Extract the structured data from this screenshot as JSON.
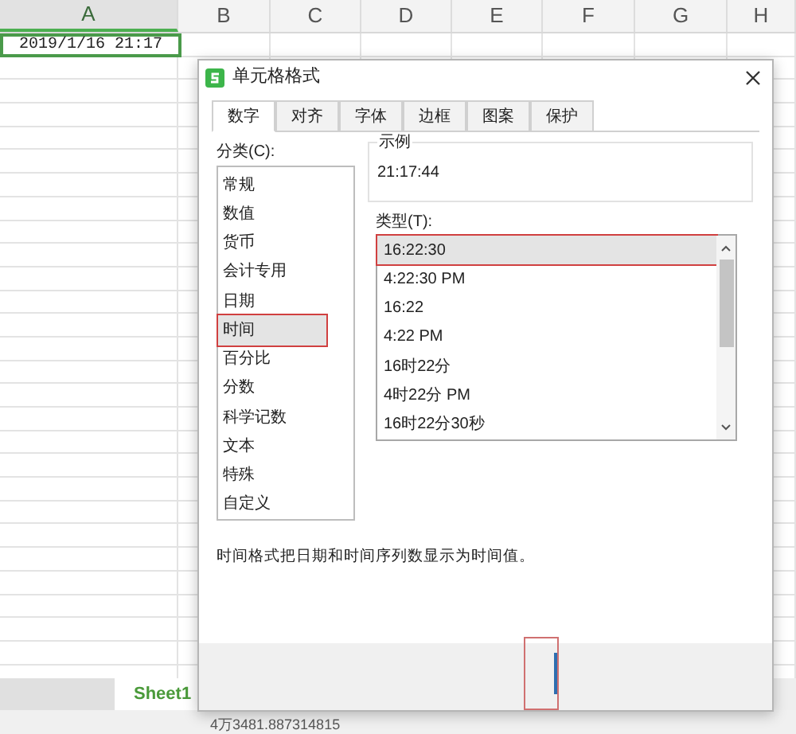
{
  "sheet": {
    "columns": [
      {
        "label": "A",
        "selected": true
      },
      {
        "label": "B",
        "selected": false
      },
      {
        "label": "C",
        "selected": false
      },
      {
        "label": "D",
        "selected": false
      },
      {
        "label": "E",
        "selected": false
      },
      {
        "label": "F",
        "selected": false
      },
      {
        "label": "G",
        "selected": false
      },
      {
        "label": "H",
        "selected": false
      }
    ],
    "active_cell": "2019/1/16 21:17",
    "sheet_tab": "Sheet1",
    "status": "4万3481.887314815"
  },
  "dialog": {
    "title": "单元格格式",
    "tabs": [
      {
        "label": "数字",
        "selected": true
      },
      {
        "label": "对齐",
        "selected": false
      },
      {
        "label": "字体",
        "selected": false
      },
      {
        "label": "边框",
        "selected": false
      },
      {
        "label": "图案",
        "selected": false
      },
      {
        "label": "保护",
        "selected": false
      }
    ],
    "category_label": "分类(C):",
    "categories": [
      {
        "label": "常规",
        "selected": false,
        "annotated": false
      },
      {
        "label": "数值",
        "selected": false,
        "annotated": false
      },
      {
        "label": "货币",
        "selected": false,
        "annotated": false
      },
      {
        "label": "会计专用",
        "selected": false,
        "annotated": false
      },
      {
        "label": "日期",
        "selected": false,
        "annotated": false
      },
      {
        "label": "时间",
        "selected": true,
        "annotated": true
      },
      {
        "label": "百分比",
        "selected": false,
        "annotated": false
      },
      {
        "label": "分数",
        "selected": false,
        "annotated": false
      },
      {
        "label": "科学记数",
        "selected": false,
        "annotated": false
      },
      {
        "label": "文本",
        "selected": false,
        "annotated": false
      },
      {
        "label": "特殊",
        "selected": false,
        "annotated": false
      },
      {
        "label": "自定义",
        "selected": false,
        "annotated": false
      }
    ],
    "sample": {
      "label": "示例",
      "value": "21:17:44"
    },
    "type_label": "类型(T):",
    "types": [
      {
        "label": "16:22:30",
        "selected": true,
        "annotated": true
      },
      {
        "label": "4:22:30 PM",
        "selected": false,
        "annotated": false
      },
      {
        "label": "16:22",
        "selected": false,
        "annotated": false
      },
      {
        "label": "4:22 PM",
        "selected": false,
        "annotated": false
      },
      {
        "label": "16时22分",
        "selected": false,
        "annotated": false
      },
      {
        "label": "4时22分 PM",
        "selected": false,
        "annotated": false
      },
      {
        "label": "16时22分30秒",
        "selected": false,
        "annotated": false
      }
    ],
    "description": "时间格式把日期和时间序列数显示为时间值。"
  }
}
